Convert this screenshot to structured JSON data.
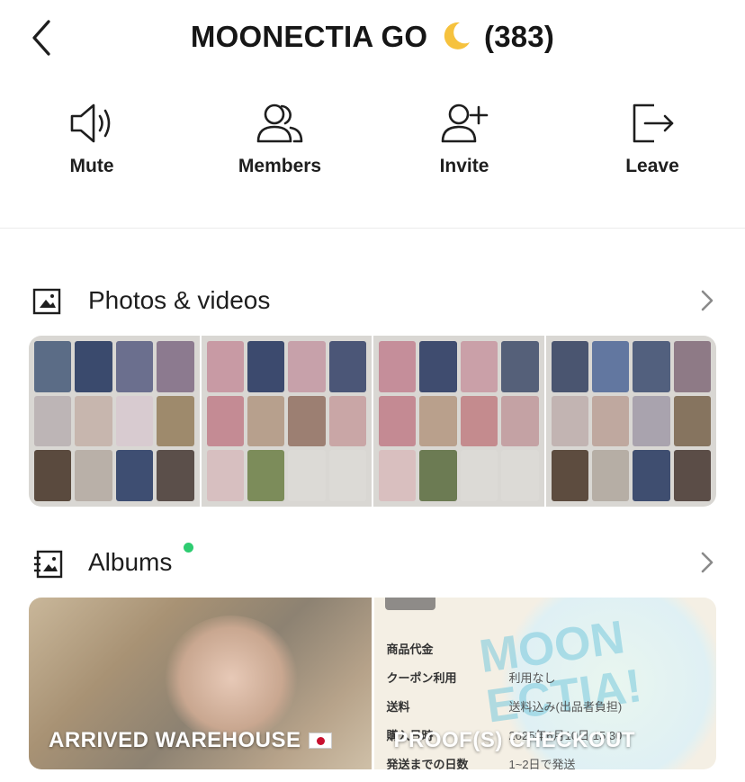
{
  "header": {
    "title": "MOONECTIA GO",
    "emoji": "🌙",
    "member_count": "(383)"
  },
  "actions": [
    {
      "label": "Mute",
      "icon": "speaker-icon"
    },
    {
      "label": "Members",
      "icon": "members-icon"
    },
    {
      "label": "Invite",
      "icon": "add-person-icon"
    },
    {
      "label": "Leave",
      "icon": "exit-icon"
    }
  ],
  "photos": {
    "title": "Photos & videos",
    "tiles": [
      {
        "colors": [
          "#5b6c86",
          "#3a4a6d",
          "#6b6f8e",
          "#8c7a8f",
          "#bdb5b6",
          "#c7b6ae",
          "#d8cbd0",
          "#9e8a6c",
          "#5a4a3e",
          "#b9b0a8",
          "#3e4e72",
          "#5b4f4a"
        ]
      },
      {
        "colors": [
          "#c89aa4",
          "#3c4a6e",
          "#c7a1aa",
          "#4b5677",
          "#c48b94",
          "#b7a08d",
          "#9c7f72",
          "#c9a6a6",
          "#d7bfc0",
          "#7c8c5a",
          "#dcdad6",
          "#dcdad6"
        ]
      },
      {
        "colors": [
          "#c58e9a",
          "#3f4c6f",
          "#caa0a8",
          "#556079",
          "#c48a93",
          "#b9a08c",
          "#c48b8e",
          "#c4a2a4",
          "#d9bfbf",
          "#6c7b53",
          "#dcdad6",
          "#dcdad6"
        ]
      },
      {
        "colors": [
          "#4a5570",
          "#6277a0",
          "#52607e",
          "#8e7a86",
          "#c2b4b2",
          "#bfa89f",
          "#a9a3ae",
          "#86745f",
          "#5d4c3f",
          "#b6aea5",
          "#3f4e70",
          "#5b4d47"
        ]
      }
    ]
  },
  "albums": {
    "title": "Albums",
    "has_new": true,
    "new_dot_color": "#2ecc71",
    "items": [
      {
        "caption": "ARRIVED WAREHOUSE",
        "flag": "Japan flag"
      },
      {
        "caption": "PROOF(S) CHECKOUT",
        "sticker": "MOON ECTIA!",
        "receipt": [
          {
            "k": "商品代金",
            "v": ""
          },
          {
            "k": "クーポン利用",
            "v": "利用なし"
          },
          {
            "k": "送料",
            "v": "送料込み(出品者負担)"
          },
          {
            "k": "購入日時",
            "v": "2025年6月10日 15:30"
          },
          {
            "k": "発送までの日数",
            "v": "1~2日で発送"
          }
        ]
      }
    ]
  }
}
